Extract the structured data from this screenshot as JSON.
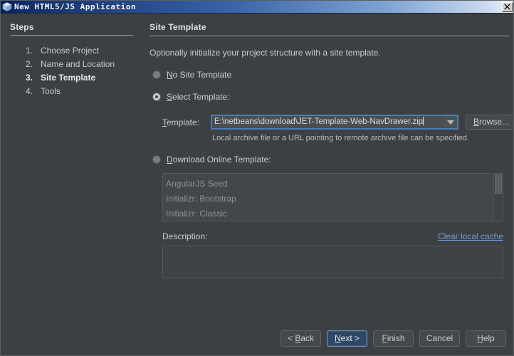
{
  "titlebar": {
    "title": "New HTML5/JS Application",
    "icon": "cube-icon",
    "close_label": "X"
  },
  "steps": {
    "heading": "Steps",
    "items": [
      {
        "num": "1.",
        "label": "Choose Project",
        "current": false
      },
      {
        "num": "2.",
        "label": "Name and Location",
        "current": false
      },
      {
        "num": "3.",
        "label": "Site Template",
        "current": true
      },
      {
        "num": "4.",
        "label": "Tools",
        "current": false
      }
    ]
  },
  "main": {
    "heading": "Site Template",
    "intro": "Optionally initialize your project structure with a site template.",
    "radios": [
      {
        "label_pre": "",
        "mnemonic": "N",
        "label_post": "o Site Template",
        "selected": false
      },
      {
        "label_pre": "",
        "mnemonic": "S",
        "label_post": "elect Template:",
        "selected": true
      },
      {
        "label_pre": "",
        "mnemonic": "D",
        "label_post": "ownload Online Template:",
        "selected": false
      }
    ],
    "template": {
      "label_mnemonic": "T",
      "label_rest": "emplate:",
      "value": "E:\\netbeans\\download\\JET-Template-Web-NavDrawer.zip",
      "dropdown_icon": "chevron-down-icon",
      "browse_mnemonic": "B",
      "browse_rest": "rowse...",
      "hint": "Local archive file or a URL pointing to remote archive file can be specified."
    },
    "online_list": {
      "items": [
        "AngularJS Seed",
        "Initializr: Bootstrap",
        "Initializr: Classic"
      ],
      "scroll_position": "top"
    },
    "description": {
      "label": "Description:",
      "clear_cache_link": "Clear local cache",
      "value": ""
    }
  },
  "footer": {
    "buttons": [
      {
        "pre": "< ",
        "mnemonic": "B",
        "post": "ack",
        "default": false,
        "name": "back-button"
      },
      {
        "pre": "",
        "mnemonic": "N",
        "post": "ext >",
        "default": true,
        "name": "next-button"
      },
      {
        "pre": "",
        "mnemonic": "F",
        "post": "inish",
        "default": false,
        "name": "finish-button"
      },
      {
        "pre": "",
        "mnemonic": "",
        "post": "Cancel",
        "default": false,
        "name": "cancel-button"
      },
      {
        "pre": "",
        "mnemonic": "H",
        "post": "elp",
        "default": false,
        "name": "help-button"
      }
    ]
  },
  "colors": {
    "background": "#3c4042",
    "text": "#c9cdce",
    "link": "#6f9fd8",
    "accent": "#4a7db5",
    "titlebar_start": "#0a1d5e",
    "titlebar_end": "#eef3fa"
  }
}
